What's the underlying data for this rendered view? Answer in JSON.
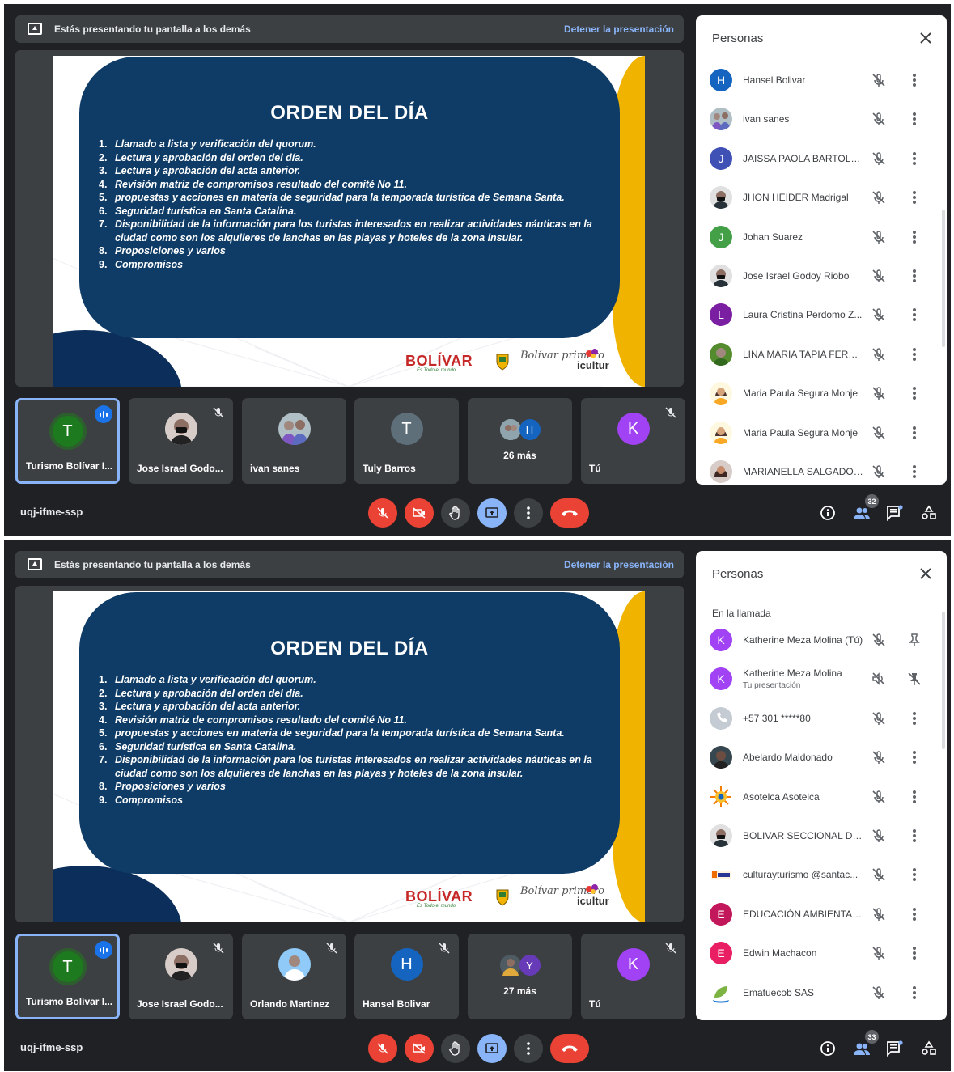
{
  "screens": [
    {
      "banner": {
        "text": "Estás presentando tu pantalla a los demás",
        "stop": "Detener la presentación"
      },
      "slide": {
        "title": "ORDEN DEL DÍA",
        "items": [
          {
            "n": "1.",
            "t": "Llamado a lista y verificación del quorum."
          },
          {
            "n": "2.",
            "t": "Lectura y aprobación del orden del día."
          },
          {
            "n": "3.",
            "t": "Lectura y aprobación del acta anterior."
          },
          {
            "n": "4.",
            "t": "Revisión matriz de compromisos resultado del comité No 11."
          },
          {
            "n": "5.",
            "t": "propuestas y acciones en materia de seguridad para la temporada turística de Semana Santa."
          },
          {
            "n": "6.",
            "t": "Seguridad turística en Santa Catalina."
          },
          {
            "n": "7.",
            "t": "Disponibilidad de la información para los turistas interesados en realizar actividades náuticas en la ciudad como son los alquileres de lanchas en las playas y hoteles de la zona insular."
          },
          {
            "n": "8.",
            "t": "Proposiciones y varios"
          },
          {
            "n": "9.",
            "t": "Compromisos"
          }
        ],
        "logo_bolivar": "BOLÍVAR",
        "logo_bolivar_sub": "Es Todo el mundo",
        "logo_primero": "Bolívar primero",
        "logo_icultur": "icultur"
      },
      "tiles": [
        {
          "name": "Turismo Bolívar I...",
          "initial": "T",
          "color": "#1e7a1e",
          "ring": "#2d5e2d",
          "type": "letter",
          "active": true,
          "speaking": true
        },
        {
          "name": "Jose Israel Godo...",
          "type": "photo-face",
          "muted": true
        },
        {
          "name": "ivan sanes",
          "type": "photo-pair"
        },
        {
          "name": "Tuly Barros",
          "initial": "T",
          "color": "#5f6f7a",
          "type": "letter"
        },
        {
          "more": "26 más",
          "a1": "photo",
          "a2": "H",
          "a2color": "#1565c0"
        },
        {
          "name": "Tú",
          "initial": "K",
          "color": "#a142f4",
          "type": "letter",
          "muted": true
        }
      ],
      "meeting_code": "uqj-ifme-ssp",
      "people_count": "32",
      "people": {
        "title": "Personas",
        "section": "",
        "rows": [
          {
            "name": "Hansel Bolivar",
            "initial": "H",
            "color": "#1565c0",
            "av": "letter"
          },
          {
            "name": "ivan sanes",
            "av": "photo-pair"
          },
          {
            "name": "JAISSA PAOLA BARTOLO...",
            "initial": "J",
            "color": "#3f51b5",
            "av": "letter"
          },
          {
            "name": "JHON HEIDER Madrigal",
            "av": "photo-face"
          },
          {
            "name": "Johan Suarez",
            "initial": "J",
            "color": "#43a047",
            "av": "letter"
          },
          {
            "name": "Jose Israel Godoy Riobo",
            "av": "photo-face"
          },
          {
            "name": "Laura Cristina Perdomo Z...",
            "initial": "L",
            "color": "#7b1fa2",
            "av": "letter"
          },
          {
            "name": "LINA MARIA TAPIA FERNA...",
            "av": "photo-green"
          },
          {
            "name": "Maria Paula Segura Monje",
            "av": "photo-woman"
          },
          {
            "name": "Maria Paula Segura Monje",
            "av": "photo-woman"
          },
          {
            "name": "MARIANELLA SALGADO ...",
            "av": "photo-woman2"
          }
        ]
      }
    },
    {
      "banner": {
        "text": "Estás presentando tu pantalla a los demás",
        "stop": "Detener la presentación"
      },
      "slide": {
        "title": "ORDEN DEL DÍA",
        "items": [
          {
            "n": "1.",
            "t": "Llamado a lista y verificación del quorum."
          },
          {
            "n": "2.",
            "t": "Lectura y aprobación del orden del día."
          },
          {
            "n": "3.",
            "t": "Lectura y aprobación del acta anterior."
          },
          {
            "n": "4.",
            "t": "Revisión matriz de compromisos resultado del comité No 11."
          },
          {
            "n": "5.",
            "t": "propuestas y acciones en materia de seguridad para la temporada turística de Semana Santa."
          },
          {
            "n": "6.",
            "t": "Seguridad turística en Santa Catalina."
          },
          {
            "n": "7.",
            "t": "Disponibilidad de la información para los turistas interesados en realizar actividades náuticas en la ciudad como son los alquileres de lanchas en las playas y hoteles de la zona insular."
          },
          {
            "n": "8.",
            "t": "Proposiciones y varios"
          },
          {
            "n": "9.",
            "t": "Compromisos"
          }
        ],
        "logo_bolivar": "BOLÍVAR",
        "logo_bolivar_sub": "Es Todo el mundo",
        "logo_primero": "Bolívar primero",
        "logo_icultur": "icultur"
      },
      "tiles": [
        {
          "name": "Turismo Bolívar I...",
          "initial": "T",
          "color": "#1e7a1e",
          "ring": "#2d5e2d",
          "type": "letter",
          "active": true,
          "speaking": true
        },
        {
          "name": "Jose Israel Godo...",
          "type": "photo-face",
          "muted": true
        },
        {
          "name": "Orlando Martinez",
          "type": "photo-man",
          "muted": true
        },
        {
          "name": "Hansel Bolivar",
          "initial": "H",
          "color": "#1565c0",
          "type": "letter",
          "muted": true
        },
        {
          "more": "27 más",
          "a1": "photo",
          "a2": "Y",
          "a2color": "#673ab7"
        },
        {
          "name": "Tú",
          "initial": "K",
          "color": "#a142f4",
          "type": "letter",
          "muted": true
        }
      ],
      "meeting_code": "uqj-ifme-ssp",
      "people_count": "33",
      "people": {
        "title": "Personas",
        "section": "En la llamada",
        "rows": [
          {
            "name": "Katherine Meza Molina (Tú)",
            "initial": "K",
            "color": "#a142f4",
            "av": "letter",
            "action": "pin"
          },
          {
            "name": "Katherine Meza Molina",
            "sub": "Tu presentación",
            "initial": "K",
            "color": "#a142f4",
            "av": "letter",
            "action": "unpin",
            "mic": "audio-off"
          },
          {
            "name": "+57 301 *****80",
            "av": "phone"
          },
          {
            "name": "Abelardo Maldonado",
            "av": "photo-dark"
          },
          {
            "name": "Asotelca Asotelca",
            "av": "sun"
          },
          {
            "name": "BOLIVAR SECCIONAL DCC",
            "av": "photo-face"
          },
          {
            "name": "culturayturismo @santac...",
            "av": "logo-smct"
          },
          {
            "name": "EDUCACIÓN AMBIENTAL ...",
            "initial": "E",
            "color": "#c2185b",
            "av": "letter"
          },
          {
            "name": "Edwin Machacon",
            "initial": "E",
            "color": "#e91e63",
            "av": "letter"
          },
          {
            "name": "Ematuecob SAS",
            "av": "leaf"
          }
        ]
      }
    }
  ],
  "colors": {
    "accent": "#8ab4f8",
    "danger": "#ea4335",
    "bar": "#202124",
    "tile": "#3c4043",
    "slide_panel": "#0f3c66",
    "slide_yellow": "#f0b400"
  }
}
